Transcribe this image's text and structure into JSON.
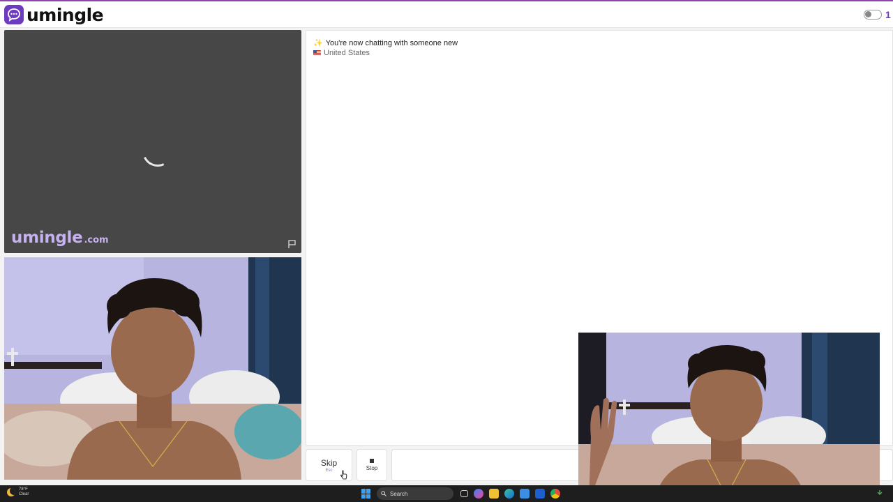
{
  "app": {
    "logo_text": "umingle",
    "header_count": "1"
  },
  "stranger_video": {
    "watermark_main": "umingle",
    "watermark_domain": ".com"
  },
  "chat": {
    "status_emoji": "✨",
    "status_message": "You're now chatting with someone new",
    "country": "United States"
  },
  "controls": {
    "skip_label": "Skip",
    "skip_shortcut": "Esc",
    "stop_label": "Stop",
    "message_placeholder": ""
  },
  "taskbar": {
    "weather_temp": "78°F",
    "weather_desc": "Clear",
    "search_label": "Search"
  },
  "colors": {
    "brand": "#6c3bbf",
    "video_bg": "#474747",
    "watermark": "#c7b2f0",
    "taskbar_bg": "#1e1e1e"
  },
  "icons": [
    "chat-bubble-icon",
    "toggle-switch-icon",
    "loading-spinner-icon",
    "flag-report-icon",
    "us-flag-icon",
    "stop-icon",
    "mouse-cursor-icon",
    "moon-weather-icon",
    "windows-start-icon",
    "search-icon"
  ]
}
